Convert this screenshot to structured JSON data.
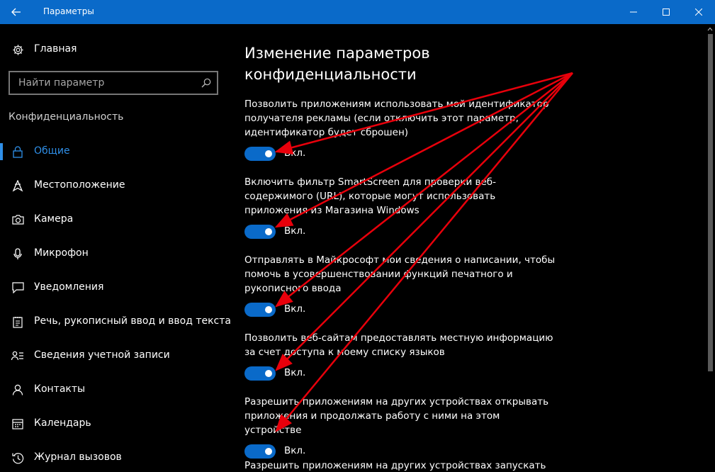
{
  "window": {
    "title": "Параметры",
    "back_icon": "back-arrow-icon",
    "minimize_icon": "minimize-icon",
    "maximize_icon": "maximize-icon",
    "close_icon": "close-icon",
    "titlebar_color": "#0a6ac9"
  },
  "sidebar": {
    "home_label": "Главная",
    "search_placeholder": "Найти параметр",
    "section_title": "Конфиденциальность",
    "accent_color": "#2f8fe8",
    "items": [
      {
        "label": "Общие",
        "icon": "lock-icon",
        "active": true
      },
      {
        "label": "Местоположение",
        "icon": "location-icon",
        "active": false
      },
      {
        "label": "Камера",
        "icon": "camera-icon",
        "active": false
      },
      {
        "label": "Микрофон",
        "icon": "microphone-icon",
        "active": false
      },
      {
        "label": "Уведомления",
        "icon": "notification-icon",
        "active": false
      },
      {
        "label": "Речь, рукописный ввод и ввод текста",
        "icon": "speech-icon",
        "active": false
      },
      {
        "label": "Сведения учетной записи",
        "icon": "account-info-icon",
        "active": false
      },
      {
        "label": "Контакты",
        "icon": "contacts-icon",
        "active": false
      },
      {
        "label": "Календарь",
        "icon": "calendar-icon",
        "active": false
      },
      {
        "label": "Журнал вызовов",
        "icon": "call-history-icon",
        "active": false
      }
    ]
  },
  "main": {
    "title": "Изменение параметров конфиденциальности",
    "settings": [
      {
        "description": "Позволить приложениям использовать мой идентификатор получателя рекламы (если отключить этот параметр, идентификатор будет сброшен)",
        "state": "Вкл.",
        "on": true
      },
      {
        "description": "Включить фильтр SmartScreen для проверки веб-содержимого (URL), которые могут использовать приложения из Магазина Windows",
        "state": "Вкл.",
        "on": true
      },
      {
        "description": "Отправлять в Майкрософт мои сведения о написании, чтобы помочь в усовершенствовании функций печатного и рукописного ввода",
        "state": "Вкл.",
        "on": true
      },
      {
        "description": "Позволить веб-сайтам предоставлять местную информацию за счет доступа к моему списку языков",
        "state": "Вкл.",
        "on": true
      },
      {
        "description": "Разрешить приложениям на других устройствах открывать приложения и продолжать работу с ними на этом устройстве",
        "state": "Вкл.",
        "on": true
      },
      {
        "description": "Разрешить приложениям на других устройствах запускать",
        "state": "",
        "on": true
      }
    ]
  },
  "annotation": {
    "arrow_color": "#e8000b"
  }
}
